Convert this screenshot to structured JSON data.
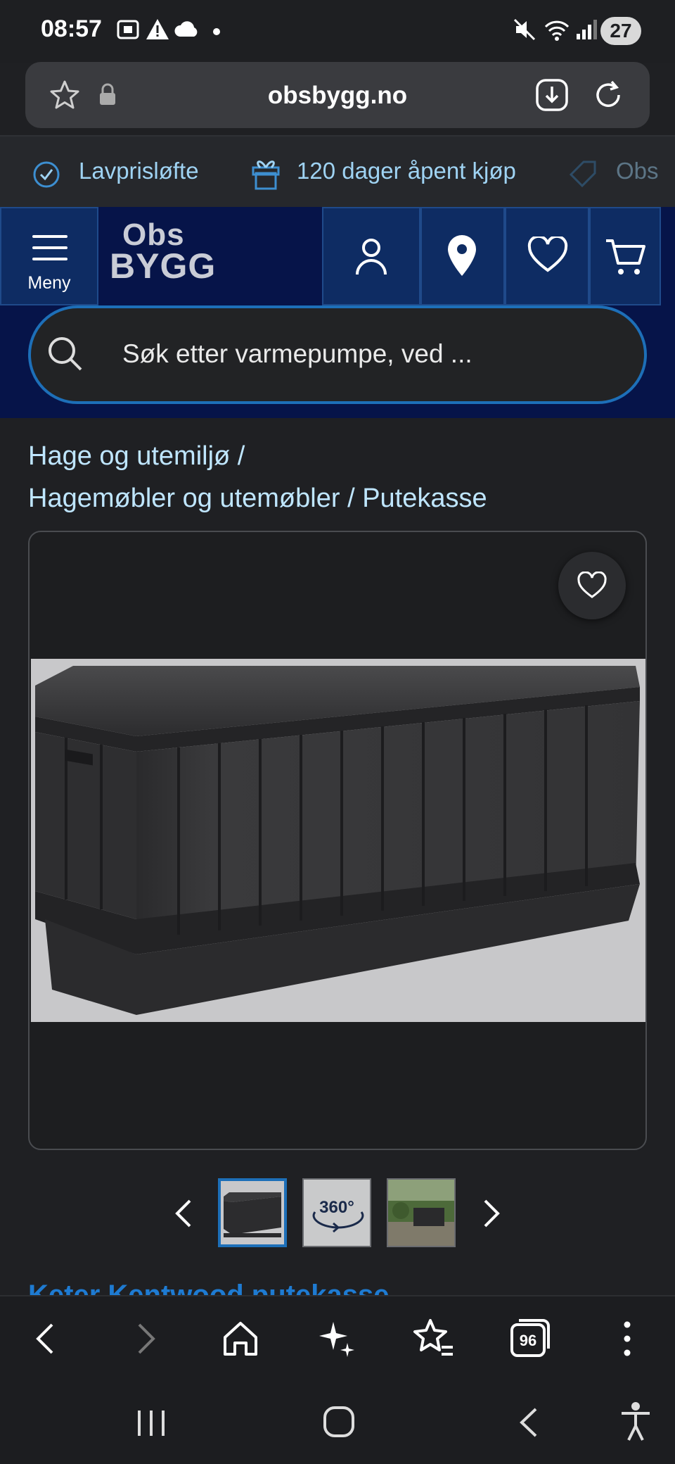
{
  "status": {
    "time": "08:57",
    "battery": "27"
  },
  "browser": {
    "url": "obsbygg.no"
  },
  "promo": {
    "items": [
      "Lavprisløfte",
      "120 dager åpent kjøp",
      "Obs"
    ]
  },
  "header": {
    "menu_label": "Meny",
    "logo_top": "Obs",
    "logo_bottom": "BYGG"
  },
  "search": {
    "placeholder": "Søk etter varmepumpe, ved ..."
  },
  "breadcrumb": {
    "line1": "Hage og utemiljø /",
    "part2": "Hagemøbler og utemøbler",
    "sep": "/",
    "part3": "Putekasse"
  },
  "gallery": {
    "thumb_360_label": "360°"
  },
  "product": {
    "title": "Keter Kentwood putekasse"
  },
  "bottom_nav": {
    "tabs_count": "96"
  },
  "colors": {
    "accent": "#1d6fb8",
    "header_bg": "#061449",
    "link": "#bfe6ff"
  }
}
